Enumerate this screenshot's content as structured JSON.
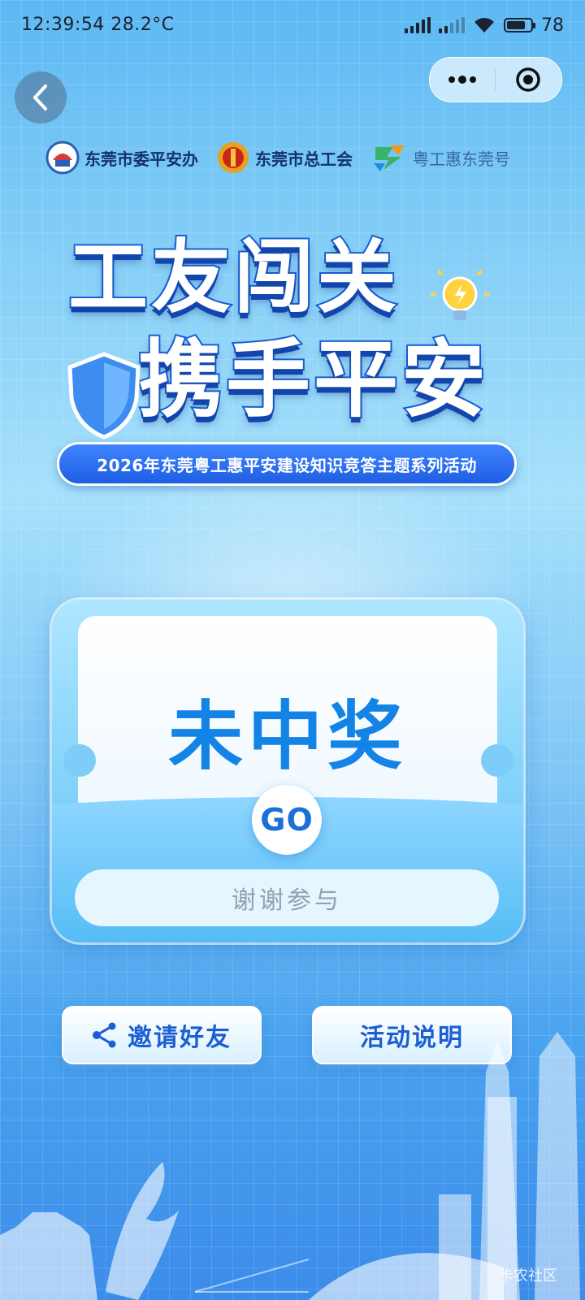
{
  "status_bar": {
    "time": "12:39:54",
    "temperature": "28.2°C",
    "battery": "78",
    "battery_level": 0.78
  },
  "nav": {
    "back_icon": "chevron-left-icon",
    "more_icon": "more-dots-icon",
    "close_icon": "target-circle-icon"
  },
  "logos": [
    {
      "name": "东莞市委平安办"
    },
    {
      "name": "东莞市总工会"
    },
    {
      "name": "粤工惠东莞号"
    }
  ],
  "title": {
    "line1": "工友闯关",
    "line2": "携手平安"
  },
  "subtitle": "2026年东莞粤工惠平安建设知识竞答主题系列活动",
  "result": {
    "status": "未中奖",
    "go_label": "GO",
    "message": "谢谢参与"
  },
  "actions": {
    "invite_label": "邀请好友",
    "invite_icon": "share-icon",
    "rules_label": "活动说明"
  },
  "watermark": "卡农社区",
  "colors": {
    "accent": "#1c5fd3",
    "result_text": "#1483e6",
    "title_stroke": "#1a5fd6"
  }
}
